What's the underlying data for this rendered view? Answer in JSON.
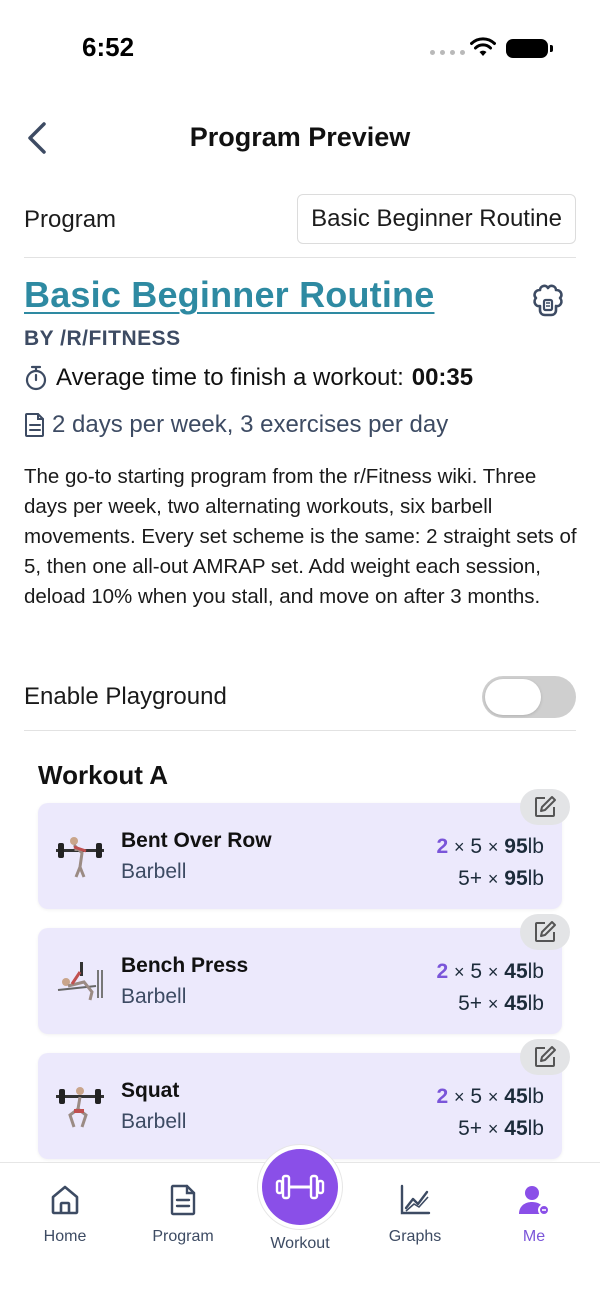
{
  "status": {
    "time": "6:52"
  },
  "header": {
    "title": "Program Preview"
  },
  "program_row": {
    "label": "Program",
    "selected": "Basic Beginner Routine"
  },
  "program": {
    "name": "Basic Beginner Routine",
    "author": "BY /R/FITNESS",
    "avg_time_label": "Average time to finish a workout:",
    "avg_time_value": "00:35",
    "days_text": "2 days per week, 3 exercises per day",
    "description": "The go-to starting program from the r/Fitness wiki. Three days per week, two alternating workouts, six barbell movements. Every set scheme is the same: 2 straight sets of 5, then one all-out AMRAP set. Add weight each session, deload 10% when you stall, and move on after 3 months."
  },
  "playground": {
    "label": "Enable Playground",
    "enabled": false
  },
  "workout": {
    "title": "Workout A",
    "exercises": [
      {
        "name": "Bent Over Row",
        "equipment": "Barbell",
        "sets": "2",
        "reps": "5",
        "weight": "95",
        "amrap_reps": "5+",
        "amrap_weight": "95",
        "unit": "lb"
      },
      {
        "name": "Bench Press",
        "equipment": "Barbell",
        "sets": "2",
        "reps": "5",
        "weight": "45",
        "amrap_reps": "5+",
        "amrap_weight": "45",
        "unit": "lb"
      },
      {
        "name": "Squat",
        "equipment": "Barbell",
        "sets": "2",
        "reps": "5",
        "weight": "45",
        "amrap_reps": "5+",
        "amrap_weight": "45",
        "unit": "lb"
      }
    ]
  },
  "tabbar": {
    "home": "Home",
    "program": "Program",
    "workout": "Workout",
    "graphs": "Graphs",
    "me": "Me",
    "active": "me"
  },
  "colors": {
    "accent": "#7a55d9",
    "link": "#2e8aa2",
    "card": "#ece9fc",
    "fab": "#8a4fe8"
  }
}
